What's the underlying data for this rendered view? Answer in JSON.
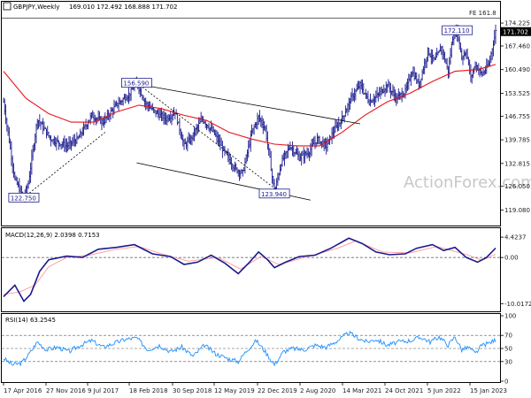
{
  "header": {
    "symbol": "GBPJPY,Weekly",
    "ohlc": "169.010 172.492 168.888 171.702",
    "fe_label": "FE 161.8"
  },
  "watermark": "ActionForex.com",
  "colors": {
    "bar": "#1a1a8c",
    "sma": "#e8141c",
    "trendline": "#000000",
    "macd_line": "#1a1a8c",
    "macd_signal": "#ff9999",
    "rsi": "#1e90ff",
    "grid_dash": "#555555",
    "current_price_bg": "#000000"
  },
  "chart_data": [
    {
      "type": "candlestick",
      "panel": "price",
      "symbol": "GBPJPY",
      "timeframe": "Weekly",
      "open": 169.01,
      "high": 172.492,
      "low": 168.888,
      "close": 171.702,
      "ylim": [
        114.5,
        180.5
      ],
      "yticks": [
        174.225,
        167.46,
        160.49,
        153.525,
        146.755,
        139.785,
        132.815,
        126.05,
        119.08
      ],
      "ytick_labels": [
        "174.225",
        "167.460",
        "160.490",
        "153.525",
        "146.755",
        "139.785",
        "132.815",
        "126.050",
        "119.080"
      ],
      "current_price_label": "171.702",
      "xtick_labels": [
        "17 Apr 2016",
        "27 Nov 2016",
        "9 Jul 2017",
        "18 Feb 2018",
        "30 Sep 2018",
        "12 May 2019",
        "22 Dec 2019",
        "2 Aug 2020",
        "14 Mar 2021",
        "24 Oct 2021",
        "5 Jun 2022",
        "15 Jan 2023"
      ],
      "path_points": [
        {
          "x": 0,
          "y": 151.0
        },
        {
          "x": 10,
          "y": 128.0
        },
        {
          "x": 18,
          "y": 122.75
        },
        {
          "x": 22,
          "y": 127.0
        },
        {
          "x": 30,
          "y": 146.0
        },
        {
          "x": 42,
          "y": 140.0
        },
        {
          "x": 56,
          "y": 138.0
        },
        {
          "x": 66,
          "y": 140.0
        },
        {
          "x": 78,
          "y": 147.0
        },
        {
          "x": 88,
          "y": 145.0
        },
        {
          "x": 100,
          "y": 150.0
        },
        {
          "x": 112,
          "y": 153.5
        },
        {
          "x": 118,
          "y": 156.59
        },
        {
          "x": 126,
          "y": 150.5
        },
        {
          "x": 134,
          "y": 148.0
        },
        {
          "x": 144,
          "y": 146.0
        },
        {
          "x": 152,
          "y": 148.0
        },
        {
          "x": 160,
          "y": 138.0
        },
        {
          "x": 166,
          "y": 140.0
        },
        {
          "x": 176,
          "y": 146.0
        },
        {
          "x": 186,
          "y": 142.0
        },
        {
          "x": 196,
          "y": 136.0
        },
        {
          "x": 206,
          "y": 131.0
        },
        {
          "x": 212,
          "y": 130.0
        },
        {
          "x": 220,
          "y": 142.0
        },
        {
          "x": 226,
          "y": 146.5
        },
        {
          "x": 232,
          "y": 143.0
        },
        {
          "x": 236,
          "y": 134.0
        },
        {
          "x": 240,
          "y": 124.0
        },
        {
          "x": 246,
          "y": 133.0
        },
        {
          "x": 254,
          "y": 138.0
        },
        {
          "x": 262,
          "y": 134.5
        },
        {
          "x": 270,
          "y": 136.0
        },
        {
          "x": 278,
          "y": 140.0
        },
        {
          "x": 286,
          "y": 138.0
        },
        {
          "x": 292,
          "y": 142.0
        },
        {
          "x": 300,
          "y": 146.0
        },
        {
          "x": 308,
          "y": 152.0
        },
        {
          "x": 316,
          "y": 156.0
        },
        {
          "x": 324,
          "y": 151.0
        },
        {
          "x": 332,
          "y": 153.0
        },
        {
          "x": 340,
          "y": 156.0
        },
        {
          "x": 348,
          "y": 152.0
        },
        {
          "x": 356,
          "y": 154.0
        },
        {
          "x": 362,
          "y": 160.0
        },
        {
          "x": 368,
          "y": 156.0
        },
        {
          "x": 376,
          "y": 166.0
        },
        {
          "x": 382,
          "y": 163.0
        },
        {
          "x": 388,
          "y": 167.0
        },
        {
          "x": 394,
          "y": 160.0
        },
        {
          "x": 398,
          "y": 170.0
        },
        {
          "x": 402,
          "y": 172.11
        },
        {
          "x": 406,
          "y": 164.0
        },
        {
          "x": 410,
          "y": 166.0
        },
        {
          "x": 414,
          "y": 158.0
        },
        {
          "x": 418,
          "y": 162.0
        },
        {
          "x": 424,
          "y": 159.0
        },
        {
          "x": 430,
          "y": 162.0
        },
        {
          "x": 436,
          "y": 171.7
        }
      ],
      "sma_points": [
        {
          "x": 0,
          "y": 160.0
        },
        {
          "x": 20,
          "y": 152.0
        },
        {
          "x": 40,
          "y": 147.5
        },
        {
          "x": 60,
          "y": 145.0
        },
        {
          "x": 80,
          "y": 145.0
        },
        {
          "x": 100,
          "y": 148.0
        },
        {
          "x": 120,
          "y": 150.0
        },
        {
          "x": 140,
          "y": 149.0
        },
        {
          "x": 160,
          "y": 147.0
        },
        {
          "x": 180,
          "y": 145.5
        },
        {
          "x": 200,
          "y": 142.0
        },
        {
          "x": 220,
          "y": 140.0
        },
        {
          "x": 240,
          "y": 138.5
        },
        {
          "x": 260,
          "y": 138.0
        },
        {
          "x": 280,
          "y": 138.0
        },
        {
          "x": 300,
          "y": 142.0
        },
        {
          "x": 320,
          "y": 147.0
        },
        {
          "x": 340,
          "y": 151.0
        },
        {
          "x": 360,
          "y": 153.5
        },
        {
          "x": 380,
          "y": 157.0
        },
        {
          "x": 400,
          "y": 160.0
        },
        {
          "x": 420,
          "y": 160.5
        },
        {
          "x": 436,
          "y": 162.0
        }
      ],
      "fe_level": 180.0,
      "annotations": [
        {
          "text": "156.590",
          "x": 118,
          "y": 156.59
        },
        {
          "text": "122.750",
          "x": 18,
          "y": 122.75
        },
        {
          "text": "123.940",
          "x": 240,
          "y": 123.94
        },
        {
          "text": "172.110",
          "x": 402,
          "y": 172.11
        }
      ],
      "trendlines": [
        {
          "from": {
            "x": 112,
            "y": 156.6
          },
          "to": {
            "x": 316,
            "y": 144.5
          }
        },
        {
          "from": {
            "x": 118,
            "y": 133.0
          },
          "to": {
            "x": 272,
            "y": 122.0
          }
        },
        {
          "from": {
            "x": 18,
            "y": 122.75
          },
          "to": {
            "x": 90,
            "y": 142.0
          }
        },
        {
          "from": {
            "x": 118,
            "y": 156.59
          },
          "to": {
            "x": 246,
            "y": 124.0
          }
        }
      ]
    },
    {
      "type": "line",
      "panel": "macd",
      "title": "MACD(12,26,9) 2.0398 0.7153",
      "ylim": [
        -11.5,
        5.6
      ],
      "yticks": [
        4.4237,
        0.0,
        -10.0172
      ],
      "ytick_labels": [
        "4.4237",
        "0.00",
        "-10.0172"
      ],
      "series": [
        {
          "name": "MACD",
          "points": [
            {
              "x": 0,
              "y": -8.5
            },
            {
              "x": 10,
              "y": -6.0
            },
            {
              "x": 18,
              "y": -9.5
            },
            {
              "x": 24,
              "y": -8.0
            },
            {
              "x": 32,
              "y": -3.0
            },
            {
              "x": 40,
              "y": -0.5
            },
            {
              "x": 56,
              "y": 0.3
            },
            {
              "x": 70,
              "y": 0.0
            },
            {
              "x": 84,
              "y": 1.8
            },
            {
              "x": 100,
              "y": 2.2
            },
            {
              "x": 116,
              "y": 2.8
            },
            {
              "x": 132,
              "y": 0.8
            },
            {
              "x": 148,
              "y": 0.2
            },
            {
              "x": 160,
              "y": -1.5
            },
            {
              "x": 172,
              "y": -1.0
            },
            {
              "x": 184,
              "y": 0.5
            },
            {
              "x": 196,
              "y": -1.2
            },
            {
              "x": 208,
              "y": -3.5
            },
            {
              "x": 218,
              "y": -1.0
            },
            {
              "x": 226,
              "y": 1.2
            },
            {
              "x": 234,
              "y": -0.5
            },
            {
              "x": 240,
              "y": -2.2
            },
            {
              "x": 250,
              "y": -1.0
            },
            {
              "x": 262,
              "y": 0.2
            },
            {
              "x": 276,
              "y": 0.5
            },
            {
              "x": 290,
              "y": 2.0
            },
            {
              "x": 306,
              "y": 4.2
            },
            {
              "x": 318,
              "y": 3.0
            },
            {
              "x": 330,
              "y": 1.2
            },
            {
              "x": 342,
              "y": 0.6
            },
            {
              "x": 356,
              "y": 0.8
            },
            {
              "x": 366,
              "y": 2.0
            },
            {
              "x": 380,
              "y": 2.8
            },
            {
              "x": 390,
              "y": 1.5
            },
            {
              "x": 400,
              "y": 2.2
            },
            {
              "x": 410,
              "y": 0.0
            },
            {
              "x": 420,
              "y": -1.0
            },
            {
              "x": 428,
              "y": 0.0
            },
            {
              "x": 436,
              "y": 2.04
            }
          ]
        },
        {
          "name": "Signal",
          "points": [
            {
              "x": 0,
              "y": -8.0
            },
            {
              "x": 14,
              "y": -7.5
            },
            {
              "x": 28,
              "y": -6.0
            },
            {
              "x": 40,
              "y": -2.0
            },
            {
              "x": 56,
              "y": 0.0
            },
            {
              "x": 76,
              "y": 0.5
            },
            {
              "x": 100,
              "y": 1.8
            },
            {
              "x": 120,
              "y": 2.4
            },
            {
              "x": 140,
              "y": 0.8
            },
            {
              "x": 164,
              "y": -0.8
            },
            {
              "x": 190,
              "y": 0.0
            },
            {
              "x": 210,
              "y": -2.5
            },
            {
              "x": 228,
              "y": 0.2
            },
            {
              "x": 244,
              "y": -1.5
            },
            {
              "x": 270,
              "y": 0.2
            },
            {
              "x": 296,
              "y": 2.0
            },
            {
              "x": 312,
              "y": 3.6
            },
            {
              "x": 336,
              "y": 1.2
            },
            {
              "x": 360,
              "y": 1.0
            },
            {
              "x": 384,
              "y": 2.4
            },
            {
              "x": 412,
              "y": 0.5
            },
            {
              "x": 424,
              "y": -0.6
            },
            {
              "x": 436,
              "y": 0.72
            }
          ]
        }
      ]
    },
    {
      "type": "line",
      "panel": "rsi",
      "title": "RSI(14) 63.2545",
      "ylim": [
        0,
        100
      ],
      "yticks": [
        100,
        70,
        50,
        30,
        0
      ],
      "ytick_labels": [
        "100",
        "70",
        "50",
        "30",
        "0"
      ],
      "series": [
        {
          "name": "RSI",
          "points": [
            {
              "x": 0,
              "y": 35
            },
            {
              "x": 8,
              "y": 25
            },
            {
              "x": 16,
              "y": 28
            },
            {
              "x": 22,
              "y": 40
            },
            {
              "x": 30,
              "y": 60
            },
            {
              "x": 38,
              "y": 48
            },
            {
              "x": 48,
              "y": 52
            },
            {
              "x": 58,
              "y": 45
            },
            {
              "x": 68,
              "y": 55
            },
            {
              "x": 78,
              "y": 62
            },
            {
              "x": 88,
              "y": 52
            },
            {
              "x": 98,
              "y": 58
            },
            {
              "x": 108,
              "y": 64
            },
            {
              "x": 118,
              "y": 66
            },
            {
              "x": 128,
              "y": 48
            },
            {
              "x": 138,
              "y": 55
            },
            {
              "x": 148,
              "y": 45
            },
            {
              "x": 158,
              "y": 52
            },
            {
              "x": 168,
              "y": 38
            },
            {
              "x": 178,
              "y": 55
            },
            {
              "x": 188,
              "y": 42
            },
            {
              "x": 198,
              "y": 35
            },
            {
              "x": 208,
              "y": 30
            },
            {
              "x": 216,
              "y": 48
            },
            {
              "x": 224,
              "y": 62
            },
            {
              "x": 232,
              "y": 45
            },
            {
              "x": 240,
              "y": 25
            },
            {
              "x": 248,
              "y": 45
            },
            {
              "x": 256,
              "y": 50
            },
            {
              "x": 266,
              "y": 48
            },
            {
              "x": 276,
              "y": 55
            },
            {
              "x": 286,
              "y": 52
            },
            {
              "x": 296,
              "y": 62
            },
            {
              "x": 306,
              "y": 74
            },
            {
              "x": 314,
              "y": 66
            },
            {
              "x": 322,
              "y": 60
            },
            {
              "x": 330,
              "y": 64
            },
            {
              "x": 340,
              "y": 55
            },
            {
              "x": 350,
              "y": 60
            },
            {
              "x": 360,
              "y": 62
            },
            {
              "x": 370,
              "y": 67
            },
            {
              "x": 378,
              "y": 60
            },
            {
              "x": 386,
              "y": 68
            },
            {
              "x": 394,
              "y": 55
            },
            {
              "x": 400,
              "y": 68
            },
            {
              "x": 406,
              "y": 48
            },
            {
              "x": 412,
              "y": 52
            },
            {
              "x": 418,
              "y": 42
            },
            {
              "x": 424,
              "y": 55
            },
            {
              "x": 430,
              "y": 58
            },
            {
              "x": 436,
              "y": 63.25
            }
          ]
        }
      ]
    }
  ]
}
